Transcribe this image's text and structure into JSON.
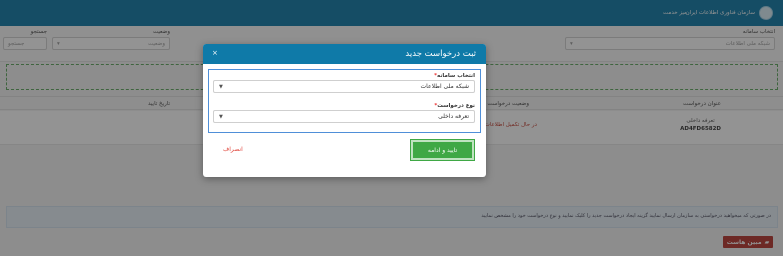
{
  "topbar": {
    "org_name": "سازمان فناوری اطلاعات ایران",
    "nav_item": "میز خدمت"
  },
  "filters": {
    "system_label": "انتخاب سامانه",
    "system_value": "شبکه ملی اطلاعات",
    "status_label": "وضعیت",
    "status_value": "وضعیت",
    "search_label": "جستجو",
    "search_placeholder": "جستجو"
  },
  "table": {
    "headers": {
      "title": "عنوان درخواست",
      "status": "وضعیت درخواست",
      "date": "تاریخ تایید"
    },
    "rows": [
      {
        "title": "تعرفه داخلی",
        "code": "AD4FD6582D",
        "status": "در حال تکمیل اطلاعات"
      }
    ]
  },
  "info_text": "در صورتی که میخواهید درخواستی به سازمان ارسال نمایید گزینه ایجاد درخواست جدید را کلیک نمایید و نوع درخواست خود را مشخص نمایید",
  "footer_badge": "مبین هاست",
  "modal": {
    "title": "ثبت درخواست جدید",
    "close": "×",
    "system_label": "انتخاب سامانه",
    "system_value": "شبکه ملی اطلاعات",
    "type_label": "نوع درخواست",
    "type_value": "تعرفه داخلی",
    "required_mark": "*",
    "confirm_label": "تایید و ادامه",
    "cancel_label": "انصراف"
  },
  "colors": {
    "brand": "#0f7aa8",
    "confirm": "#3fa845",
    "cancel": "#e0443a",
    "status_warning": "#c0392b"
  }
}
